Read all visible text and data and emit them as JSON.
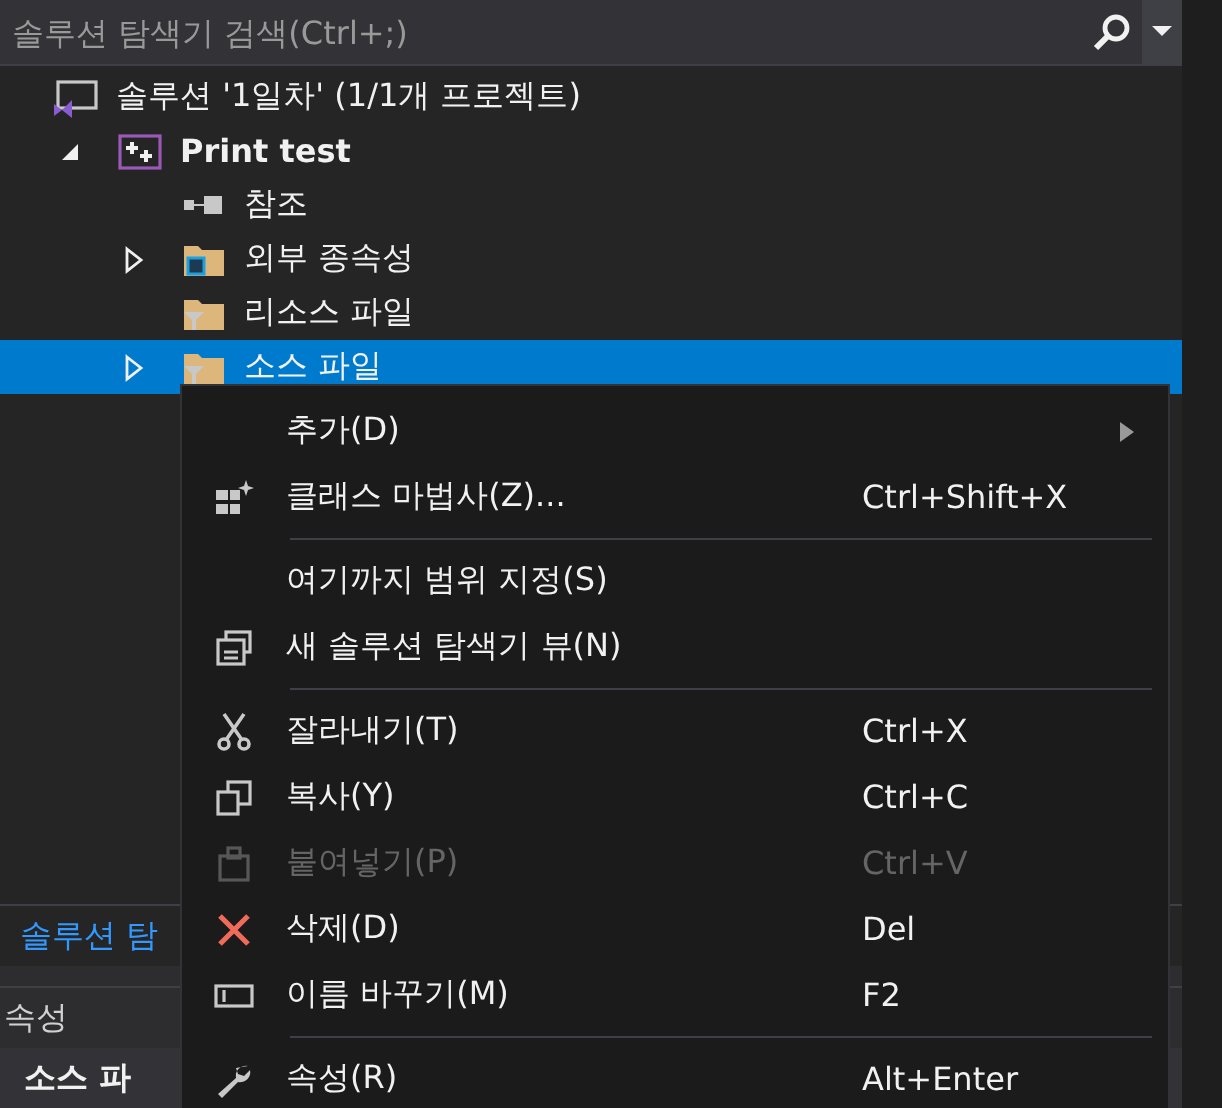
{
  "search": {
    "placeholder": "솔루션 탐색기 검색(Ctrl+;)"
  },
  "tree": [
    {
      "label": "솔루션 '1일차' (1/1개 프로젝트)",
      "kind": "solution",
      "selected": false,
      "children": [
        {
          "label": "Print test",
          "kind": "project",
          "expanded": true,
          "selected": false,
          "children": [
            {
              "label": "참조",
              "kind": "references",
              "selected": false
            },
            {
              "label": "외부 종속성",
              "kind": "folder",
              "expanded": false,
              "selected": false
            },
            {
              "label": "리소스 파일",
              "kind": "filter",
              "selected": false
            },
            {
              "label": "소스 파일",
              "kind": "filter",
              "expanded": false,
              "selected": true
            }
          ]
        }
      ]
    }
  ],
  "bottom_tabs": [
    {
      "label": "솔루션 탐",
      "selected": true
    }
  ],
  "properties": {
    "title": "속성",
    "object": "소스 파"
  },
  "context_menu": [
    {
      "kind": "item",
      "label": "추가(D)",
      "submenu": true,
      "disabled": false
    },
    {
      "kind": "item",
      "label": "클래스 마법사(Z)...",
      "shortcut": "Ctrl+Shift+X",
      "disabled": false
    },
    {
      "kind": "separator"
    },
    {
      "kind": "item",
      "label": "여기까지 범위 지정(S)",
      "disabled": false
    },
    {
      "kind": "item",
      "label": "새 솔루션 탐색기 뷰(N)",
      "disabled": false
    },
    {
      "kind": "separator"
    },
    {
      "kind": "item",
      "label": "잘라내기(T)",
      "shortcut": "Ctrl+X",
      "disabled": false
    },
    {
      "kind": "item",
      "label": "복사(Y)",
      "shortcut": "Ctrl+C",
      "disabled": false
    },
    {
      "kind": "item",
      "label": "붙여넣기(P)",
      "shortcut": "Ctrl+V",
      "disabled": true
    },
    {
      "kind": "item",
      "label": "삭제(D)",
      "shortcut": "Del",
      "disabled": false
    },
    {
      "kind": "item",
      "label": "이름 바꾸기(M)",
      "shortcut": "F2",
      "disabled": false
    },
    {
      "kind": "separator"
    },
    {
      "kind": "item",
      "label": "속성(R)",
      "shortcut": "Alt+Enter",
      "disabled": false
    }
  ]
}
